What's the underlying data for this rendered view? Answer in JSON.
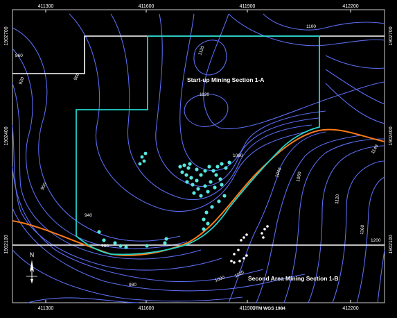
{
  "map": {
    "coordinate_system": "UTM WGS 1984",
    "north_label": "N",
    "x_ticks": [
      "411300",
      "411600",
      "411900",
      "412200"
    ],
    "y_ticks": [
      "1902700",
      "1902400",
      "1902100"
    ],
    "area_labels": {
      "section_1a": "Start-up Mining Section 1-A",
      "section_1b": "Second Area Mining Section 1-B"
    },
    "contour_labels": [
      "1100",
      "1120",
      "1120",
      "1060",
      "1040",
      "1060",
      "1120",
      "1140",
      "1160",
      "1200",
      "1000",
      "1020",
      "980",
      "940",
      "960",
      "960",
      "920",
      "900",
      "860"
    ],
    "colors": {
      "background": "#000000",
      "contour": "#5a6cf0",
      "mining_boundary": "#22d3c8",
      "drill_holes_1a": "#55e8e0",
      "drill_holes_1b": "#ffffff",
      "road": "#ff7a1a",
      "grid_lines": "#ffffff"
    },
    "icons": [
      "north-arrow-icon"
    ]
  }
}
